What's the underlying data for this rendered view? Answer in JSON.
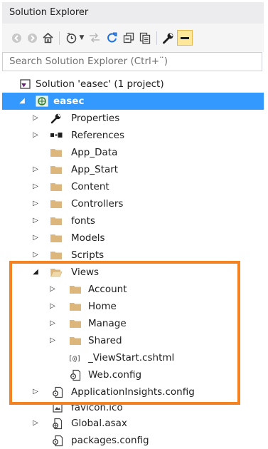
{
  "window": {
    "title": "Solution Explorer"
  },
  "search": {
    "placeholder": "Search Solution Explorer (Ctrl+¨)"
  },
  "toolbar": {
    "buttons": [
      "back-icon",
      "forward-icon",
      "home-icon",
      "pending-changes-filter-icon",
      "dropdown-arrow-icon",
      "sync-with-active-document-icon",
      "refresh-icon",
      "collapse-all-icon",
      "show-all-files-icon",
      "properties-wrench-icon",
      "preview-selected-items-icon"
    ]
  },
  "tree": {
    "solution": "Solution 'easec' (1 project)",
    "project": "easec",
    "items": {
      "properties": "Properties",
      "references": "References",
      "app_data": "App_Data",
      "app_start": "App_Start",
      "content": "Content",
      "controllers": "Controllers",
      "fonts": "fonts",
      "models": "Models",
      "scripts": "Scripts",
      "views": "Views",
      "account": "Account",
      "home": "Home",
      "manage": "Manage",
      "shared": "Shared",
      "viewstart": "_ViewStart.cshtml",
      "views_webconfig": "Web.config",
      "appinsights": "ApplicationInsights.config",
      "favicon": "favicon.ico",
      "global": "Global.asax",
      "packages": "packages.config"
    }
  },
  "colors": {
    "selection": "#3399ff",
    "highlight_border": "#f58220",
    "folder": "#dcb67a"
  }
}
